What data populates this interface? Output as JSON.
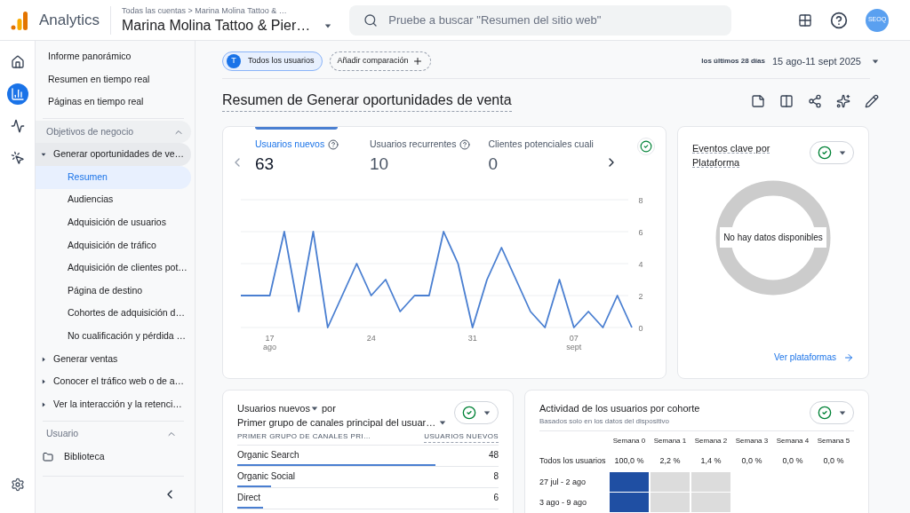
{
  "header": {
    "product": "Analytics",
    "breadcrumb": "Todas las cuentas > Marina Molina Tattoo & …",
    "property": "Marina Molina Tattoo & Pier…",
    "search_placeholder": "Pruebe a buscar \"Resumen del sitio web\"",
    "avatar": "SEOQ"
  },
  "rail": [
    {
      "selected": false
    },
    {
      "selected": true
    },
    {
      "selected": false
    },
    {
      "selected": false
    }
  ],
  "sidebar": {
    "top_items": [
      "Informe panorámico",
      "Resumen en tiempo real",
      "Páginas en tiempo real"
    ],
    "sections": [
      {
        "title": "Objetivos de negocio",
        "expanded": true,
        "items": [
          {
            "label": "Generar oportunidades de ve…",
            "expanded": true,
            "children": [
              {
                "label": "Resumen",
                "selected": true
              },
              {
                "label": "Audiencias",
                "selected": false
              },
              {
                "label": "Adquisición de usuarios",
                "selected": false
              },
              {
                "label": "Adquisición de tráfico",
                "selected": false
              },
              {
                "label": "Adquisición de clientes pot…",
                "selected": false
              },
              {
                "label": "Página de destino",
                "selected": false
              },
              {
                "label": "Cohortes de adquisición d…",
                "selected": false
              },
              {
                "label": "No cualificación y pérdida …",
                "selected": false
              }
            ]
          },
          {
            "label": "Generar ventas",
            "expanded": false
          },
          {
            "label": "Conocer el tráfico web o de a…",
            "expanded": false
          },
          {
            "label": "Ver la interacción y la retenci…",
            "expanded": false
          }
        ]
      },
      {
        "title": "Usuario",
        "expanded": true,
        "items": [
          {
            "label": "Biblioteca",
            "kind": "folder"
          }
        ]
      }
    ]
  },
  "filters": {
    "segment_initial": "T",
    "segment": "Todos los usuarios",
    "add_comparison": "Añadir comparación",
    "range_label": "los últimos 28 días",
    "range": "15 ago-11 sept 2025"
  },
  "page_title": "Resumen de Generar oportunidades de venta",
  "main_card": {
    "metrics": [
      {
        "label": "Usuarios nuevos",
        "value": "63",
        "help": true,
        "selected": true
      },
      {
        "label": "Usuarios recurrentes",
        "value": "10",
        "help": true,
        "selected": false
      },
      {
        "label": "Clientes potenciales cuali",
        "value": "0",
        "help": false,
        "selected": false
      }
    ],
    "chart_data": {
      "type": "line",
      "categories": [
        null,
        null,
        "17 ago",
        null,
        null,
        null,
        null,
        null,
        null,
        "24",
        null,
        null,
        null,
        null,
        null,
        null,
        "31",
        null,
        null,
        null,
        null,
        null,
        null,
        "07 sept",
        null,
        null,
        null,
        null
      ],
      "series": [
        {
          "color": "#4a7fd1",
          "values": [
            2,
            2,
            2,
            6,
            1,
            6,
            0,
            2,
            4,
            2,
            3,
            1,
            2,
            2,
            6,
            4,
            0,
            3,
            5,
            3,
            1,
            0,
            3,
            0,
            1,
            0,
            2,
            0
          ]
        }
      ],
      "ylim": [
        0,
        8
      ],
      "yticks": [
        0,
        2,
        4,
        6,
        8
      ],
      "grid": true
    }
  },
  "platform_card": {
    "title": "Eventos clave por Plataforma",
    "empty": "No hay datos disponibles",
    "link": "Ver plataformas"
  },
  "channel_card": {
    "title_metric": "Usuarios nuevos",
    "title_by": "por",
    "title_dimension": "Primer grupo de canales principal del usuar…",
    "columns": [
      "PRIMER GRUPO DE CANALES PRI…",
      "USUARIOS NUEVOS"
    ],
    "rows": [
      {
        "name": "Organic Search",
        "value": "48",
        "level": 0.76
      },
      {
        "name": "Organic Social",
        "value": "8",
        "level": 0.13
      },
      {
        "name": "Direct",
        "value": "6",
        "level": 0.1
      }
    ]
  },
  "cohort_card": {
    "title": "Actividad de los usuarios por cohorte",
    "subtitle": "Basados solo en los datos del dispositivo",
    "columns": [
      "Semana 0",
      "Semana 1",
      "Semana 2",
      "Semana 3",
      "Semana 4",
      "Semana 5"
    ],
    "summary": {
      "label": "Todos los usuarios",
      "values": [
        "100,0 %",
        "2,2 %",
        "1,4 %",
        "0,0 %",
        "0,0 %",
        "0,0 %"
      ]
    },
    "rows": [
      {
        "label": "27 jul - 2 ago",
        "cells": [
          {
            "color": "#1f4fa3"
          },
          {
            "color": "#dcdcdc"
          },
          {
            "color": "#dcdcdc"
          }
        ]
      },
      {
        "label": "3 ago - 9 ago",
        "cells": [
          {
            "color": "#1f4fa3"
          },
          {
            "color": "#dcdcdc"
          },
          {
            "color": "#dcdcdc"
          }
        ]
      }
    ]
  }
}
